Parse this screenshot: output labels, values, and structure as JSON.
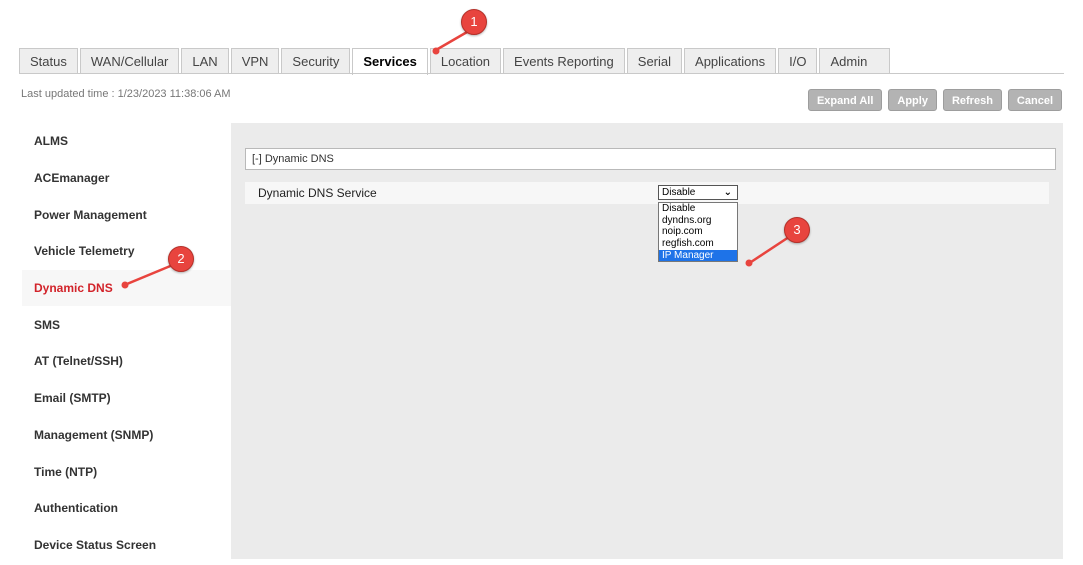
{
  "tabs": [
    {
      "label": "Status",
      "active": false
    },
    {
      "label": "WAN/Cellular",
      "active": false
    },
    {
      "label": "LAN",
      "active": false
    },
    {
      "label": "VPN",
      "active": false
    },
    {
      "label": "Security",
      "active": false
    },
    {
      "label": "Services",
      "active": true
    },
    {
      "label": "Location",
      "active": false
    },
    {
      "label": "Events Reporting",
      "active": false
    },
    {
      "label": "Serial",
      "active": false
    },
    {
      "label": "Applications",
      "active": false
    },
    {
      "label": "I/O",
      "active": false
    },
    {
      "label": "Admin",
      "active": false
    }
  ],
  "updated_text": "Last updated time : 1/23/2023 11:38:06 AM",
  "buttons": {
    "expand_all": "Expand All",
    "apply": "Apply",
    "refresh": "Refresh",
    "cancel": "Cancel"
  },
  "sidebar": {
    "items": [
      {
        "label": "ALMS"
      },
      {
        "label": "ACEmanager"
      },
      {
        "label": "Power Management"
      },
      {
        "label": "Vehicle Telemetry"
      },
      {
        "label": "Dynamic DNS"
      },
      {
        "label": "SMS"
      },
      {
        "label": "AT (Telnet/SSH)"
      },
      {
        "label": "Email (SMTP)"
      },
      {
        "label": "Management (SNMP)"
      },
      {
        "label": "Time (NTP)"
      },
      {
        "label": "Authentication"
      },
      {
        "label": "Device Status Screen"
      }
    ],
    "active_index": 4
  },
  "section": {
    "title": "[-] Dynamic DNS",
    "field_label": "Dynamic DNS Service",
    "select_value": "Disable",
    "options": [
      "Disable",
      "dyndns.org",
      "noip.com",
      "regfish.com",
      "IP Manager"
    ],
    "highlighted_option": "IP Manager"
  },
  "annotations": [
    {
      "number": "1",
      "target": "Services tab"
    },
    {
      "number": "2",
      "target": "Dynamic DNS menu item"
    },
    {
      "number": "3",
      "target": "IP Manager option"
    }
  ],
  "colors": {
    "annotation": "#e8443e",
    "active_menu": "#d2232a",
    "selected_option": "#1e73e8",
    "button": "#b3b3b3",
    "content_bg": "#ebebeb"
  }
}
